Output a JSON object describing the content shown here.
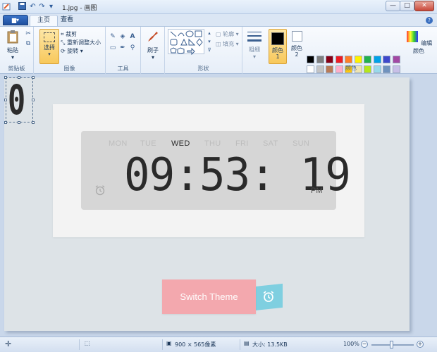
{
  "window": {
    "title": "1.jpg - 画图",
    "min": "—",
    "max": "□",
    "close": "✕"
  },
  "tabs": {
    "menu": "▆▾",
    "home": "主页",
    "view": "查看"
  },
  "ribbon": {
    "clipboard": {
      "paste": "粘贴",
      "label": "剪贴板"
    },
    "image": {
      "select": "选择",
      "crop": "裁剪",
      "resize": "重新调整大小",
      "rotate": "旋转",
      "label": "图像"
    },
    "tools": {
      "label": "工具"
    },
    "brushes": {
      "label": "刷子"
    },
    "shapes": {
      "outline": "轮廓",
      "fill": "填充",
      "label": "形状"
    },
    "size": {
      "label": "粗细"
    },
    "colors": {
      "color1": "颜色 1",
      "color2": "颜色 2",
      "edit": "编辑颜色",
      "label": "颜色",
      "palette_row1": [
        "#000000",
        "#7f7f7f",
        "#880015",
        "#ed1c24",
        "#ff7f27",
        "#fff200",
        "#22b14c",
        "#00a2e8",
        "#3f48cc",
        "#a349a4"
      ],
      "palette_row2": [
        "#ffffff",
        "#c3c3c3",
        "#b97a57",
        "#ffaec9",
        "#ffc90e",
        "#efe4b0",
        "#b5e61d",
        "#99d9ea",
        "#7092be",
        "#c8bfe7"
      ]
    }
  },
  "canvas_content": {
    "corner_digit": "0",
    "days": [
      {
        "label": "MON",
        "active": false
      },
      {
        "label": "TUE",
        "active": false
      },
      {
        "label": "WED",
        "active": true
      },
      {
        "label": "THU",
        "active": false
      },
      {
        "label": "FRI",
        "active": false
      },
      {
        "label": "SAT",
        "active": false
      },
      {
        "label": "SUN",
        "active": false
      }
    ],
    "time": "09:53: 19",
    "ampm": "PM",
    "switch_theme": "Switch Theme"
  },
  "statusbar": {
    "dimensions": "900 × 565像素",
    "filesize": "大小: 13.5KB",
    "zoom": "100%",
    "zoom_minus": "−",
    "zoom_plus": "+"
  }
}
